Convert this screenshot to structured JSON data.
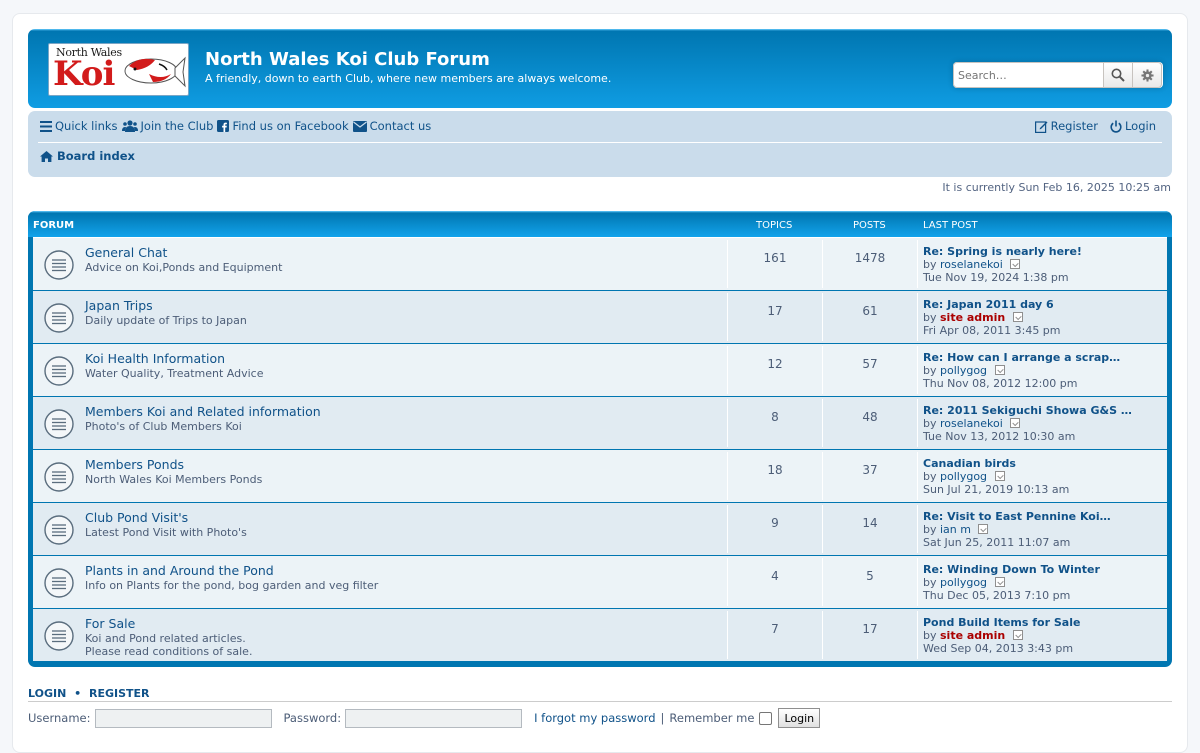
{
  "header": {
    "logo_top": "North Wales",
    "logo_main": "Koi",
    "title": "North Wales Koi Club Forum",
    "description": "A friendly, down to earth Club, where new members are always welcome.",
    "search_placeholder": "Search…"
  },
  "nav": {
    "quick_links": "Quick links",
    "join": "Join the Club",
    "facebook": "Find us on Facebook",
    "contact": "Contact us",
    "register": "Register",
    "login": "Login",
    "board_index": "Board index"
  },
  "current_time": "It is currently Sun Feb 16, 2025 10:25 am",
  "table_head": {
    "forum": "FORUM",
    "topics": "TOPICS",
    "posts": "POSTS",
    "last_post": "LAST POST"
  },
  "forums": [
    {
      "title": "General Chat",
      "desc1": "Advice on Koi,Ponds and Equipment",
      "desc2": "",
      "topics": "161",
      "posts": "1478",
      "lp_title": "Re: Spring is nearly here!",
      "lp_by": "by",
      "lp_user": "roselanekoi",
      "lp_admin": false,
      "lp_date": "Tue Nov 19, 2024 1:38 pm"
    },
    {
      "title": "Japan Trips",
      "desc1": "Daily update of Trips to Japan",
      "desc2": "",
      "topics": "17",
      "posts": "61",
      "lp_title": "Re: Japan 2011 day 6",
      "lp_by": "by",
      "lp_user": "site admin",
      "lp_admin": true,
      "lp_date": "Fri Apr 08, 2011 3:45 pm"
    },
    {
      "title": "Koi Health Information",
      "desc1": "Water Quality, Treatment Advice",
      "desc2": "",
      "topics": "12",
      "posts": "57",
      "lp_title": "Re: How can I arrange a scrap…",
      "lp_by": "by",
      "lp_user": "pollygog",
      "lp_admin": false,
      "lp_date": "Thu Nov 08, 2012 12:00 pm"
    },
    {
      "title": "Members Koi and Related information",
      "desc1": "Photo's of Club Members Koi",
      "desc2": "",
      "topics": "8",
      "posts": "48",
      "lp_title": "Re: 2011 Sekiguchi Showa G&S …",
      "lp_by": "by",
      "lp_user": "roselanekoi",
      "lp_admin": false,
      "lp_date": "Tue Nov 13, 2012 10:30 am"
    },
    {
      "title": "Members Ponds",
      "desc1": "North Wales Koi Members Ponds",
      "desc2": "",
      "topics": "18",
      "posts": "37",
      "lp_title": "Canadian birds",
      "lp_by": "by",
      "lp_user": "pollygog",
      "lp_admin": false,
      "lp_date": "Sun Jul 21, 2019 10:13 am"
    },
    {
      "title": "Club Pond Visit's",
      "desc1": "Latest Pond Visit with Photo's",
      "desc2": "",
      "topics": "9",
      "posts": "14",
      "lp_title": "Re: Visit to East Pennine Koi…",
      "lp_by": "by",
      "lp_user": "ian m",
      "lp_admin": false,
      "lp_date": "Sat Jun 25, 2011 11:07 am"
    },
    {
      "title": "Plants in and Around the Pond",
      "desc1": "Info on Plants for the pond, bog garden and veg filter",
      "desc2": "",
      "topics": "4",
      "posts": "5",
      "lp_title": "Re: Winding Down To Winter",
      "lp_by": "by",
      "lp_user": "pollygog",
      "lp_admin": false,
      "lp_date": "Thu Dec 05, 2013 7:10 pm"
    },
    {
      "title": "For Sale",
      "desc1": "Koi and Pond related articles.",
      "desc2": "Please read conditions of sale.",
      "topics": "7",
      "posts": "17",
      "lp_title": "Pond Build Items for Sale",
      "lp_by": "by",
      "lp_user": "site admin",
      "lp_admin": true,
      "lp_date": "Wed Sep 04, 2013 3:43 pm"
    }
  ],
  "login": {
    "login_link": "LOGIN",
    "dot": "•",
    "register_link": "REGISTER",
    "username_label": "Username:",
    "password_label": "Password:",
    "forgot": "I forgot my password",
    "sep": "|",
    "remember": "Remember me",
    "button": "Login"
  },
  "colors": {
    "brand": "#0076b1",
    "link": "#105289",
    "admin": "#AA0000",
    "navbar": "#cadceb"
  }
}
